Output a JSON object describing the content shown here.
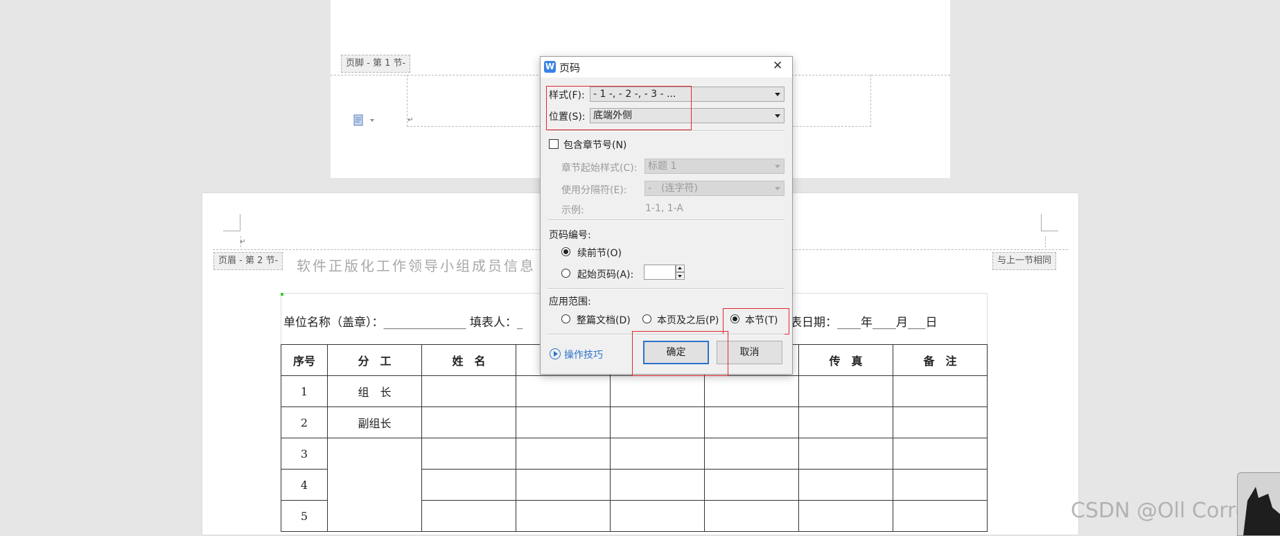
{
  "doc": {
    "page1": {
      "footer_tag": "页脚 - 第 1 节-"
    },
    "page2": {
      "header_tag": "页眉 - 第 2 节-",
      "same_as_prev": "与上一节相同",
      "title_partial": "软件正版化工作领导小组成员信息",
      "unit_line_left": "单位名称（盖章）：______________ 填表人：_",
      "unit_line_right": "表日期：____年____月___日",
      "table_headers": [
        "序号",
        "分　工",
        "姓　名",
        "",
        "",
        "",
        "传　真",
        "备　注"
      ],
      "rows": [
        [
          "1",
          "组　长"
        ],
        [
          "2",
          "副组长"
        ],
        [
          "3",
          ""
        ],
        [
          "4",
          ""
        ],
        [
          "5",
          ""
        ]
      ]
    },
    "watermark": "CSDN @Oll Correct"
  },
  "dialog": {
    "title": "页码",
    "close_label": "✕",
    "style_label": "样式(F):",
    "style_value": "- 1 -, - 2 -, - 3 - ...",
    "position_label": "位置(S):",
    "position_value": "底端外侧",
    "include_chapter_label": "包含章节号(N)",
    "chapter_start_label": "章节起始样式(C):",
    "chapter_start_value": "标题 1",
    "separator_label": "使用分隔符(E):",
    "separator_value": "-　(连字符)",
    "example_label": "示例:",
    "example_value": "1-1, 1-A",
    "numbering_label": "页码编号:",
    "continue_label": "续前节(O)",
    "start_at_label": "起始页码(A):",
    "start_at_value": "",
    "scope_label": "应用范围:",
    "scope_whole": "整篇文档(D)",
    "scope_after": "本页及之后(P)",
    "scope_section": "本节(T)",
    "tips_label": "操作技巧",
    "ok_label": "确定",
    "cancel_label": "取消"
  },
  "colors": {
    "accent": "#2a73c8",
    "highlight_box": "#e0262f",
    "wps_logo": "#3b82e6"
  }
}
